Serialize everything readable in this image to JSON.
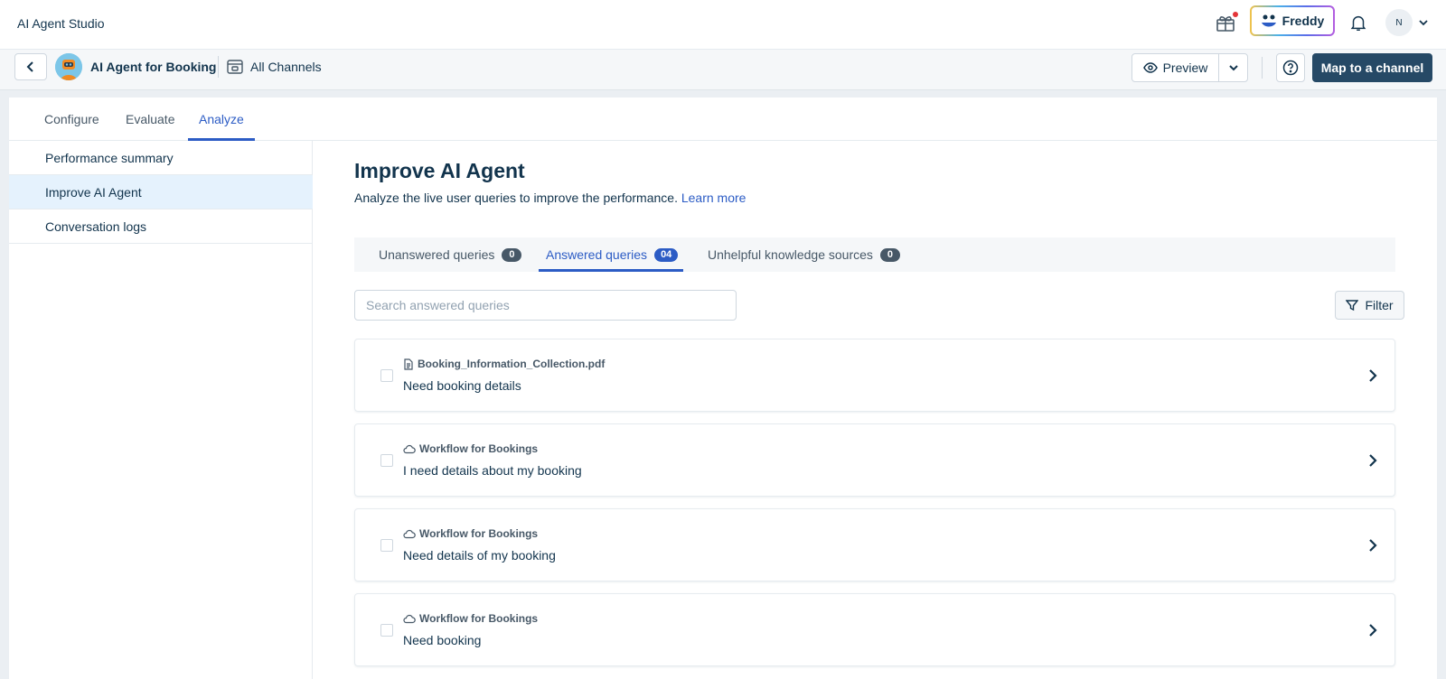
{
  "app": {
    "title": "AI Agent Studio"
  },
  "topbar": {
    "freddy_label": "Freddy",
    "avatar_initial": "N"
  },
  "agent": {
    "name": "AI Agent for Booking",
    "channels_label": "All Channels"
  },
  "actions": {
    "preview_label": "Preview",
    "map_label": "Map to a channel"
  },
  "tabs": [
    {
      "label": "Configure",
      "active": false
    },
    {
      "label": "Evaluate",
      "active": false
    },
    {
      "label": "Analyze",
      "active": true
    }
  ],
  "sidenav": [
    {
      "label": "Performance summary",
      "active": false
    },
    {
      "label": "Improve AI Agent",
      "active": true
    },
    {
      "label": "Conversation logs",
      "active": false
    }
  ],
  "page": {
    "title": "Improve AI Agent",
    "description": "Analyze the live user queries to improve the performance.",
    "learn_more": "Learn more"
  },
  "query_tabs": [
    {
      "label": "Unanswered queries",
      "count": "0",
      "active": false
    },
    {
      "label": "Answered queries",
      "count": "04",
      "active": true
    },
    {
      "label": "Unhelpful knowledge sources",
      "count": "0",
      "active": false
    }
  ],
  "search": {
    "placeholder": "Search answered queries"
  },
  "filter": {
    "label": "Filter"
  },
  "queries": [
    {
      "source": "Booking_Information_Collection.pdf",
      "source_icon": "document-icon",
      "text": "Need booking details"
    },
    {
      "source": "Workflow for Bookings",
      "source_icon": "cloud-icon",
      "text": "I need details about my booking"
    },
    {
      "source": "Workflow for Bookings",
      "source_icon": "cloud-icon",
      "text": "Need details of my booking"
    },
    {
      "source": "Workflow for Bookings",
      "source_icon": "cloud-icon",
      "text": "Need booking"
    }
  ],
  "colors": {
    "accent": "#2c5cc5",
    "primary_button": "#264966",
    "text": "#12344d",
    "active_nav": "#e5f2fd"
  }
}
